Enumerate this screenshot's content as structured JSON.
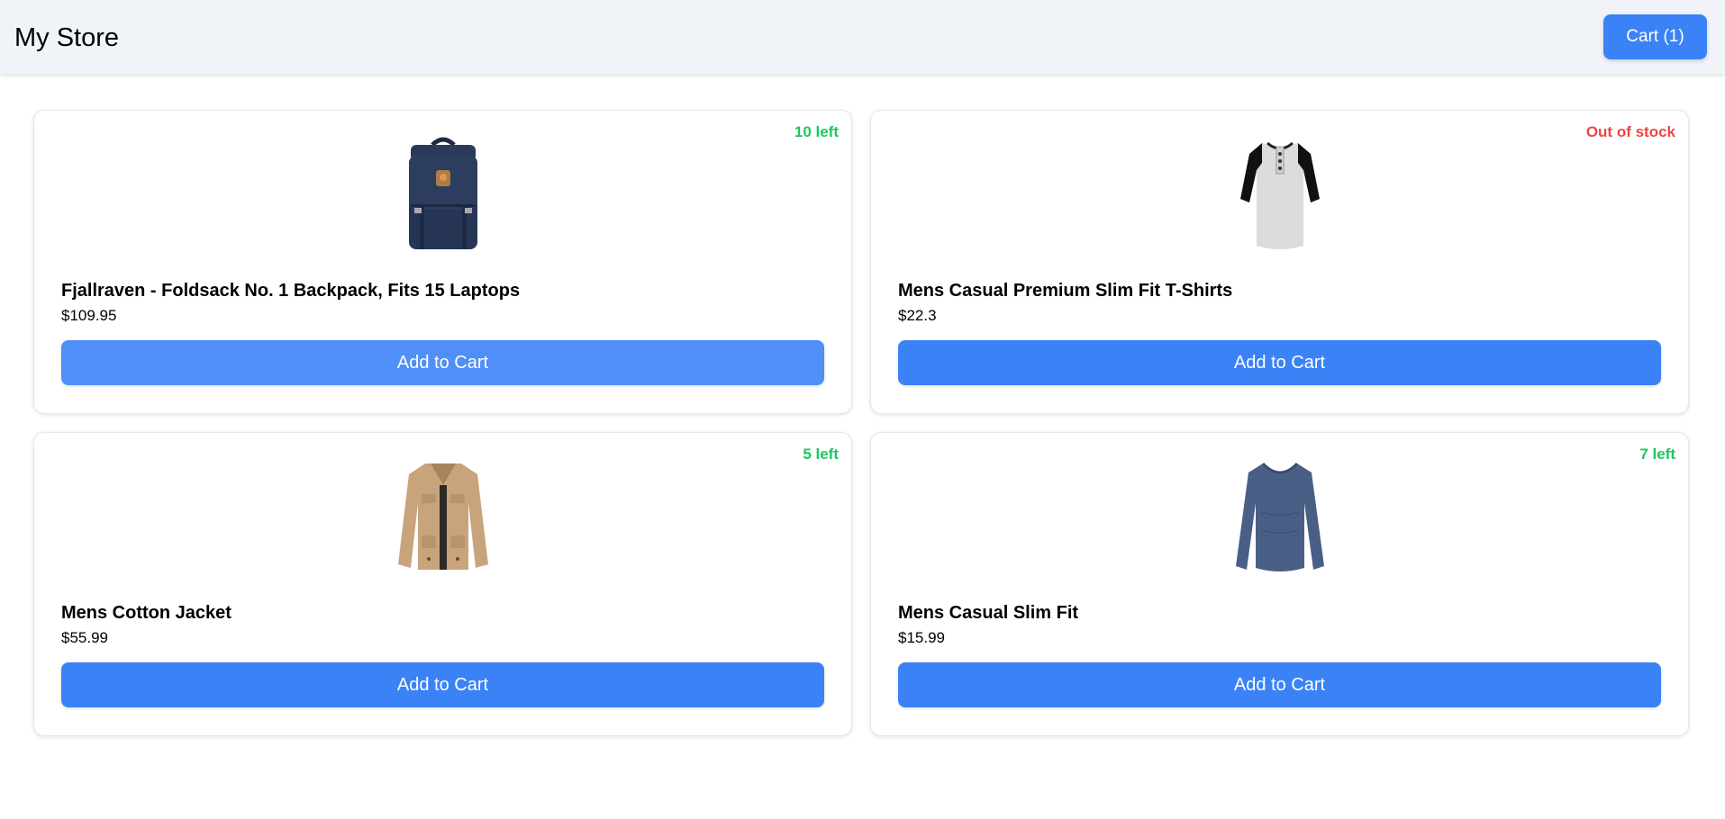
{
  "header": {
    "title": "My Store",
    "cart_label": "Cart (1)",
    "cart_color": "#3b82f6"
  },
  "products": [
    {
      "name": "Fjallraven - Foldsack No. 1 Backpack, Fits 15 Laptops",
      "price": "$109.95",
      "stock": "10 left",
      "stock_status": "in-stock",
      "image": "backpack-image",
      "button_label": "Add to Cart"
    },
    {
      "name": "Mens Casual Premium Slim Fit T-Shirts",
      "price": "$22.3",
      "stock": "Out of stock",
      "stock_status": "out-of-stock",
      "image": "raglan-tshirt-image",
      "button_label": "Add to Cart"
    },
    {
      "name": "Mens Cotton Jacket",
      "price": "$55.99",
      "stock": "5 left",
      "stock_status": "in-stock",
      "image": "cotton-jacket-image",
      "button_label": "Add to Cart"
    },
    {
      "name": "Mens Casual Slim Fit",
      "price": "$15.99",
      "stock": "7 left",
      "stock_status": "in-stock",
      "image": "longsleeve-shirt-image",
      "button_label": "Add to Cart"
    }
  ],
  "colors": {
    "in_stock": "#22c55e",
    "out_of_stock": "#ef4444",
    "button": "#3b82f6",
    "header_bg": "#f0f3f8"
  }
}
